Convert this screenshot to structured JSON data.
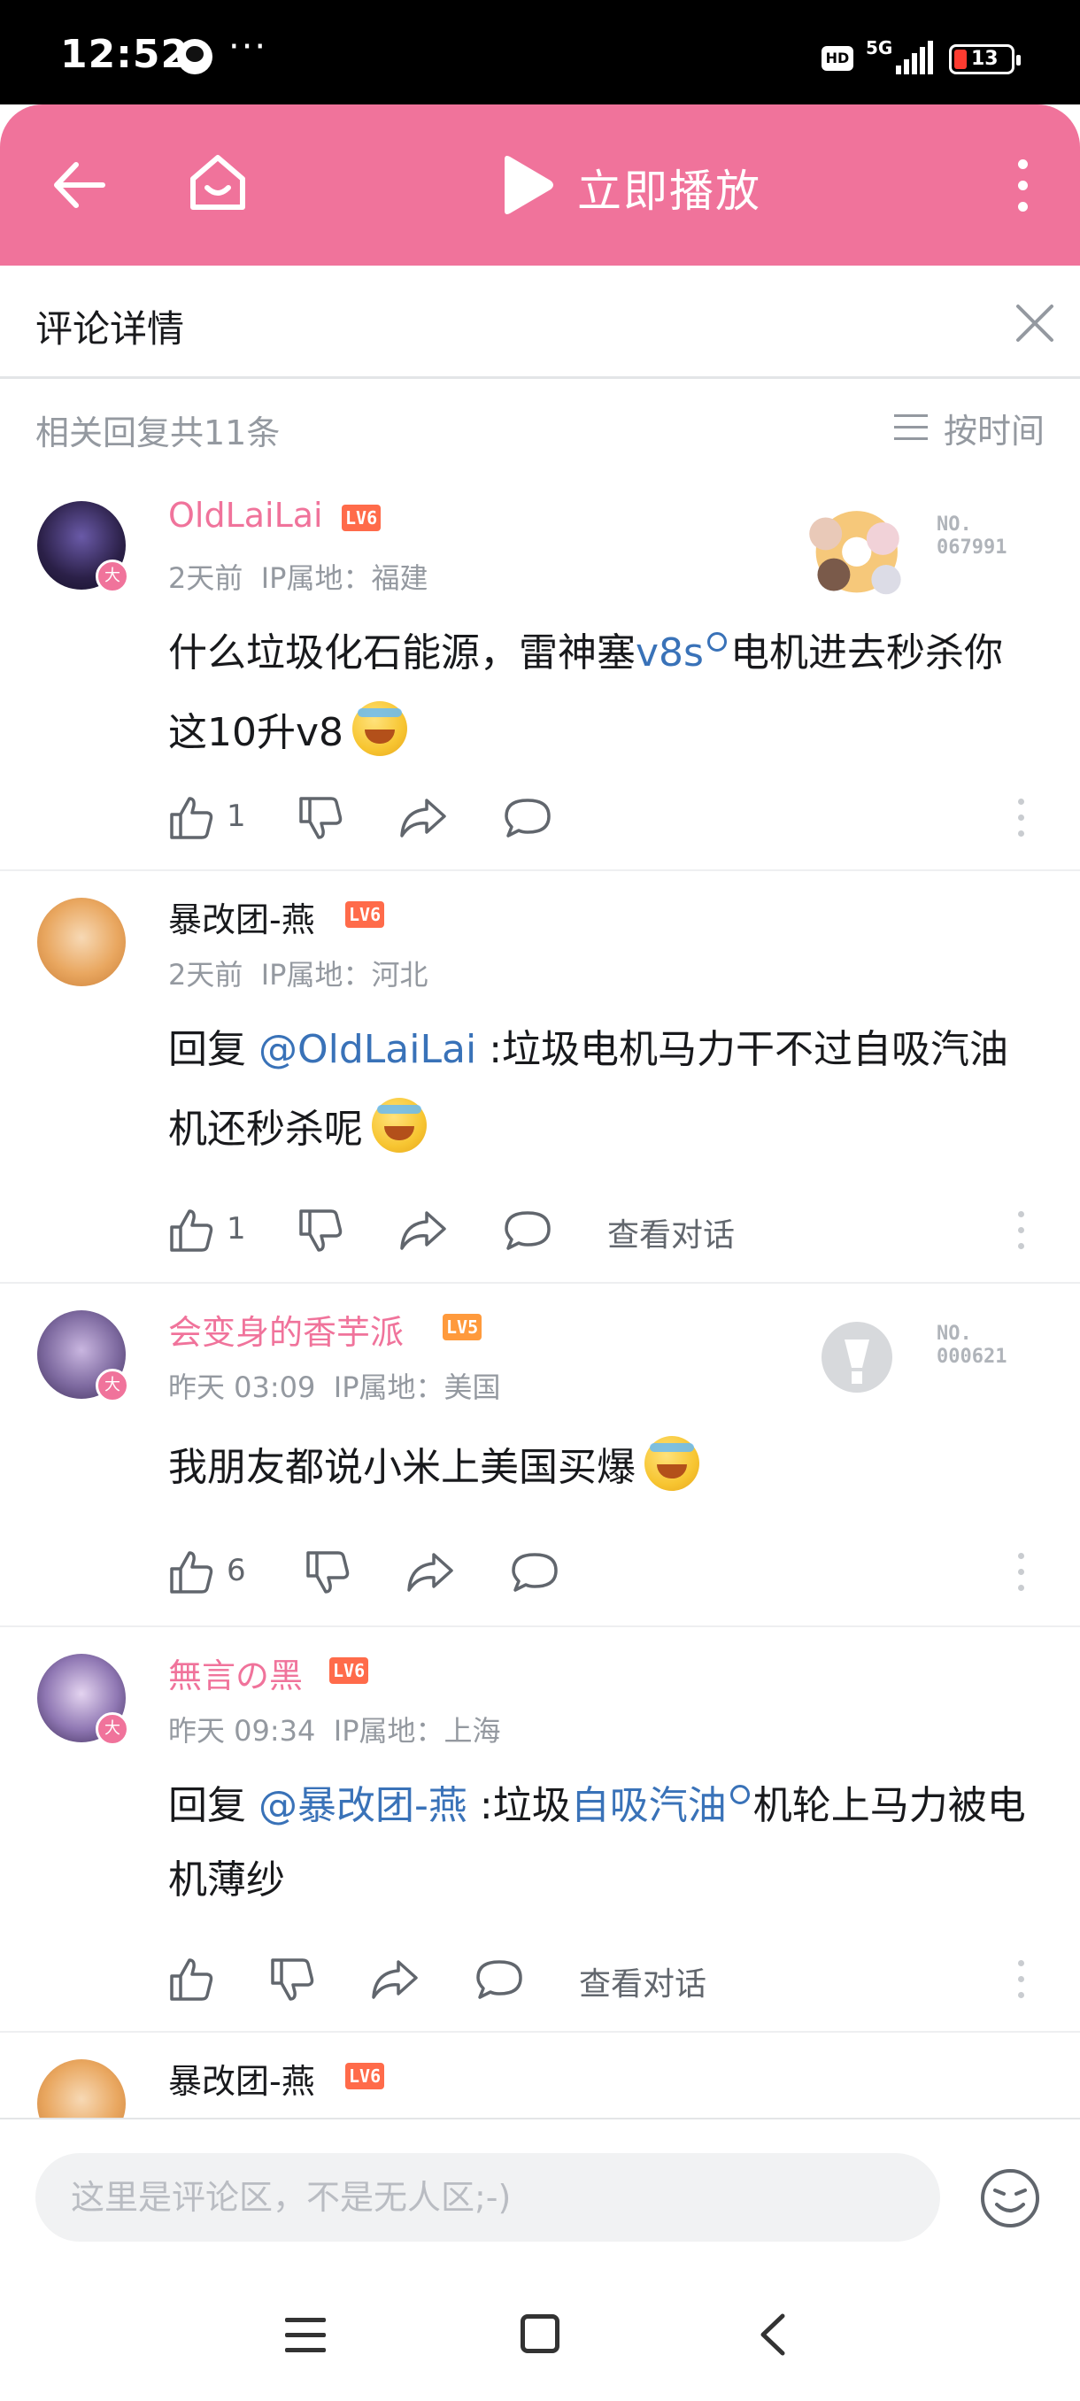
{
  "status_bar": {
    "time": "12:52",
    "dots": "···",
    "hd": "HD",
    "network": "5G",
    "battery": "13"
  },
  "header": {
    "play_label": "立即播放"
  },
  "detail": {
    "title": "评论详情"
  },
  "replies": {
    "count_label": "相关回复共11条",
    "sort_label": "按时间"
  },
  "comments": [
    {
      "username": "OldLaiLai",
      "level": "LV6",
      "time": "2天前",
      "ip": "IP属地：福建",
      "text_before": "什么垃圾化石能源，雷神塞",
      "link": "v8s",
      "text_after": "电机进去秒杀你这10升v8",
      "likes": "1",
      "decoration_no": "NO.\n067991"
    },
    {
      "username": "暴改团-燕",
      "level": "LV6",
      "time": "2天前",
      "ip": "IP属地：河北",
      "reply_prefix": "回复 ",
      "mention": "@OldLaiLai",
      "text": " :垃圾电机马力干不过自吸汽油机还秒杀呢",
      "likes": "1",
      "view_conversation": "查看对话"
    },
    {
      "username": "会变身的香芋派",
      "level": "LV5",
      "time": "昨天 03:09",
      "ip": "IP属地：美国",
      "text": "我朋友都说小米上美国买爆",
      "likes": "6",
      "decoration_no": "NO.\n000621"
    },
    {
      "username": "無言の黑",
      "level": "LV6",
      "time": "昨天 09:34",
      "ip": "IP属地：上海",
      "reply_prefix": "回复 ",
      "mention": "@暴改团-燕",
      "text_mid": " :垃圾",
      "link": "自吸汽油",
      "text_after": "机轮上马力被电机薄纱",
      "view_conversation": "查看对话"
    },
    {
      "username": "暴改团-燕",
      "level": "LV6"
    }
  ],
  "input": {
    "placeholder": "这里是评论区，不是无人区;-)"
  },
  "colors": {
    "brand_pink": "#f0739b",
    "link_blue": "#3972b8",
    "level6": "#ff6b4a",
    "level5": "#ff9a3c"
  },
  "icons": [
    "back-arrow-icon",
    "home-icon",
    "play-icon",
    "more-vertical-icon",
    "close-icon",
    "sort-icon",
    "like-icon",
    "dislike-icon",
    "share-icon",
    "reply-icon",
    "emoji-icon",
    "search-icon"
  ]
}
